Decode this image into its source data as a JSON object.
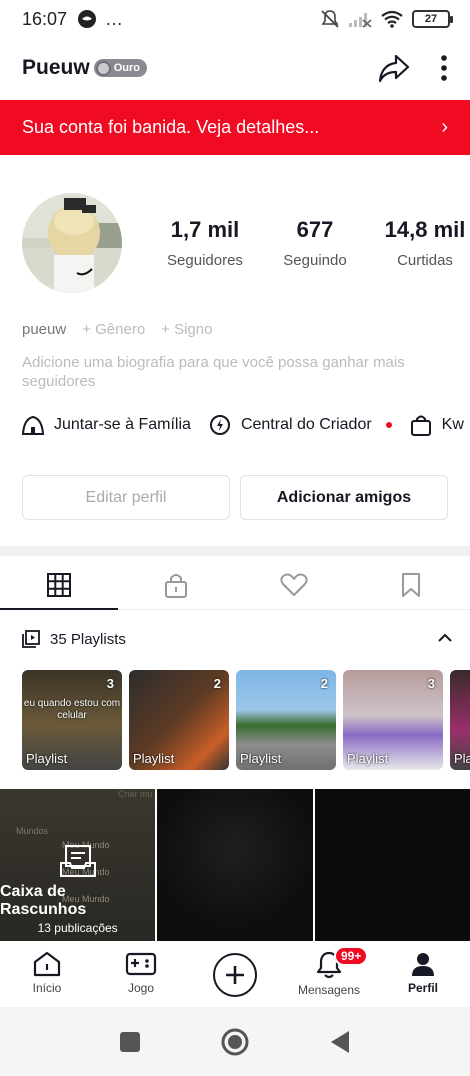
{
  "status_bar": {
    "time": "16:07",
    "more": "…",
    "battery": "27"
  },
  "header": {
    "username": "Pueuw",
    "badge_label": "Ouro"
  },
  "ban_banner": {
    "text": "Sua conta foi banida. Veja detalhes..."
  },
  "stats": [
    {
      "value": "1,7 mil",
      "label": "Seguidores"
    },
    {
      "value": "677",
      "label": "Seguindo"
    },
    {
      "value": "14,8 mil",
      "label": "Curtidas"
    }
  ],
  "meta": {
    "handle": "pueuw",
    "add_gender": "+ Gênero",
    "add_sign": "+ Signo"
  },
  "bio_placeholder": "Adicione uma biografia para que você possa ganhar mais seguidores",
  "links": [
    {
      "label": "Juntar-se à Família",
      "icon": "family-icon"
    },
    {
      "label": "Central do Criador",
      "icon": "creator-center-icon"
    },
    {
      "label": "Kw",
      "icon": "shop-bag-icon"
    }
  ],
  "buttons": {
    "edit_profile": "Editar perfil",
    "add_friends": "Adicionar amigos"
  },
  "tabs": [
    {
      "name": "grid-icon",
      "active": true
    },
    {
      "name": "lock-icon",
      "active": false
    },
    {
      "name": "heart-icon",
      "active": false
    },
    {
      "name": "bookmark-icon",
      "active": false
    }
  ],
  "playlists": {
    "header": "35 Playlists",
    "items": [
      {
        "count": "3",
        "label": "Playlist",
        "caption": "eu quando estou com celular"
      },
      {
        "count": "2",
        "label": "Playlist",
        "caption": ""
      },
      {
        "count": "2",
        "label": "Playlist",
        "caption": ""
      },
      {
        "count": "3",
        "label": "Playlist",
        "caption": ""
      },
      {
        "count": "",
        "label": "Pla",
        "caption": ""
      }
    ]
  },
  "drafts": {
    "title": "Caixa de Rascunhos",
    "subtitle": "13 publicações",
    "ui_labels": [
      "Criar mu",
      "Mundos",
      "Meu Mundo",
      "Meu Mundo",
      "Meu Mundo"
    ]
  },
  "bottom_nav": [
    {
      "label": "Início",
      "icon": "home-icon"
    },
    {
      "label": "Jogo",
      "icon": "gamepad-icon"
    },
    {
      "label": "",
      "icon": "plus-icon"
    },
    {
      "label": "Mensagens",
      "icon": "bell-icon",
      "badge": "99+"
    },
    {
      "label": "Perfil",
      "icon": "profile-icon",
      "active": true
    }
  ],
  "colors": {
    "banner_red": "#f00a22",
    "text_primary": "#161823"
  }
}
